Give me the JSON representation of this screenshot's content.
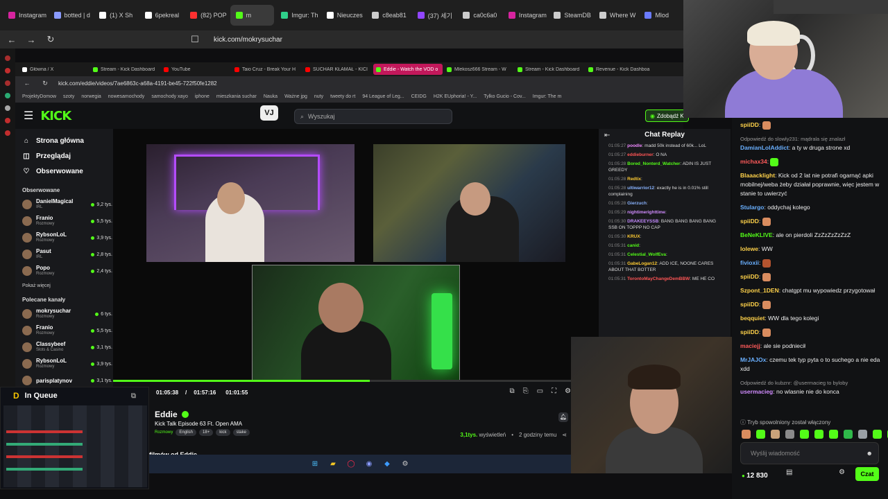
{
  "outer_browser": {
    "tabs": [
      {
        "label": "Instagram",
        "color": "#d6249f"
      },
      {
        "label": "botted | d",
        "color": "#8a9bff"
      },
      {
        "label": "(1) X Sh",
        "color": "#ffffff"
      },
      {
        "label": "6pekreal",
        "color": "#ffffff"
      },
      {
        "label": "(82) POP",
        "color": "#ff3030"
      },
      {
        "label": "m",
        "color": "#53fc18",
        "active": true
      },
      {
        "label": "Imgur: Th",
        "color": "#2fd08a"
      },
      {
        "label": "Nieuczes",
        "color": "#ffffff"
      },
      {
        "label": "c8eab81",
        "color": "#cccccc"
      },
      {
        "label": "(37) 세기",
        "color": "#9146ff"
      },
      {
        "label": "ca0c6a0",
        "color": "#cccccc"
      },
      {
        "label": "Instagram",
        "color": "#d6249f"
      },
      {
        "label": "SteamDB",
        "color": "#cccccc"
      },
      {
        "label": "Where W",
        "color": "#cccccc"
      },
      {
        "label": "Mlod",
        "color": "#6a7bff"
      }
    ],
    "url": "kick.com/mokrysuchar"
  },
  "inner_browser": {
    "tabs": [
      {
        "label": "Główna / X",
        "color": "#ffffff"
      },
      {
        "label": "Stream - Kick Dashboard",
        "color": "#53fc18"
      },
      {
        "label": "YouTube",
        "color": "#ff0000"
      },
      {
        "label": "Taio Cruz - Break Your H",
        "color": "#ff0000"
      },
      {
        "label": "SUCHAR KŁAMAŁ - KICI",
        "color": "#ff0000"
      },
      {
        "label": "Eddie - Watch the VOD o",
        "color": "#53fc18",
        "active": true
      },
      {
        "label": "Mlekosz666 Stream - W",
        "color": "#53fc18"
      },
      {
        "label": "Stream - Kick Dashboard",
        "color": "#53fc18"
      },
      {
        "label": "Revenue - Kick Dashboa",
        "color": "#53fc18"
      }
    ],
    "url": "kick.com/eddie/videos/7ae6863c-a68a-4191-be45-722f50fe1282",
    "bookmarks": [
      "ProjektyDomow",
      "szoty",
      "norwegia",
      "nowesamochody",
      "samochody xayo",
      "iphone",
      "mieszkania suchar",
      "Nauka",
      "Ważne jpg",
      "nuty",
      "tweety do rt",
      "94 League of Leg...",
      "CEIDG",
      "H2K EUphoria! - Y...",
      "Tylko Gucio - Cov...",
      "Imgur: The m"
    ]
  },
  "kick": {
    "logo": "KICK",
    "search_placeholder": "Wyszukaj",
    "cta": "Zdobądź K",
    "vj_label": "VJ",
    "nav": [
      {
        "label": "Strona główna",
        "icon": "home-icon",
        "glyph": "⌂"
      },
      {
        "label": "Przeglądaj",
        "icon": "browse-icon",
        "glyph": "◫"
      },
      {
        "label": "Obserwowane",
        "icon": "heart-icon",
        "glyph": "♡"
      }
    ],
    "followed_title": "Obserwowane",
    "followed": [
      {
        "name": "DanielMagical",
        "category": "IRL",
        "viewers": "9,2 tys."
      },
      {
        "name": "Franio",
        "category": "Rozmowy",
        "viewers": "5,5 tys."
      },
      {
        "name": "RybsonLoL",
        "category": "Rozmowy",
        "viewers": "3,9 tys."
      },
      {
        "name": "Pasut",
        "category": "IRL",
        "viewers": "2,8 tys."
      },
      {
        "name": "Popo",
        "category": "Rozmowy",
        "viewers": "2,4 tys."
      }
    ],
    "show_more": "Pokaż więcej",
    "recommended_title": "Polecane kanały",
    "recommended": [
      {
        "name": "mokrysuchar",
        "category": "Rozmowy",
        "viewers": "6 tys."
      },
      {
        "name": "Franio",
        "category": "Rozmowy",
        "viewers": "5,5 tys."
      },
      {
        "name": "Classybeef",
        "category": "Slots & Casino",
        "viewers": "3,1 tys."
      },
      {
        "name": "RybsonLoL",
        "category": "Rozmowy",
        "viewers": "3,9 tys."
      },
      {
        "name": "parisplatynov",
        "category": "",
        "viewers": "3,1 tys."
      }
    ],
    "video": {
      "current_time": "01:05:38",
      "duration": "01:57:16",
      "hover_time": "01:01:55",
      "progress": 0.56,
      "streamer": "Eddie",
      "title": "Kick Talk Episode 63 Ft. Open AMA",
      "category": "Rozmowy",
      "tags": [
        "English",
        "18+",
        "kick",
        "stake"
      ],
      "views": "3,1tys.",
      "views_label": "wyświetleń",
      "age": "2 godziny temu",
      "more_from": "filmów od Eddie"
    },
    "replay": {
      "title": "Chat Replay",
      "messages": [
        {
          "time": "01:05:27",
          "user": "poodle",
          "color": "#f08aff",
          "text": "madd 50k instead of 60k... LoL"
        },
        {
          "time": "01:05:27",
          "user": "eddieburner",
          "color": "#ff5555",
          "text": "O NA"
        },
        {
          "time": "01:05:28",
          "user": "Bored_Nonterd_Watcher",
          "color": "#53fc18",
          "text": "ADIN IS JUST GREEDY"
        },
        {
          "time": "01:05:28",
          "user": "Redtix",
          "color": "#ffcc33",
          "text": ""
        },
        {
          "time": "01:05:28",
          "user": "ultiwarrior12",
          "color": "#8ab4ff",
          "text": "exactly he is in 0.01% still complaining"
        },
        {
          "time": "01:05:28",
          "user": "Gierzuch",
          "color": "#8ab4ff",
          "text": ""
        },
        {
          "time": "01:05:29",
          "user": "nightimerighttime",
          "color": "#d18cff",
          "text": ""
        },
        {
          "time": "01:05:30",
          "user": "DRAKEEYSSB",
          "color": "#c58cff",
          "text": "BANG BANG BANG BANG SSB ON TOPPP NO CAP"
        },
        {
          "time": "01:05:30",
          "user": "KRUX",
          "color": "#ffcc33",
          "text": ""
        },
        {
          "time": "01:05:31",
          "user": "canid",
          "color": "#53fc18",
          "text": ""
        },
        {
          "time": "01:05:31",
          "user": "Celestial_WolfEva",
          "color": "#53fc18",
          "text": ""
        },
        {
          "time": "01:05:31",
          "user": "GabeLogan12",
          "color": "#ffcc33",
          "text": "ADD ICE, NOONE CARES ABOUT THAT BOTTER"
        },
        {
          "time": "01:05:31",
          "user": "TorontoMayChangeDemBBW",
          "color": "#ff5555",
          "text": "ME HE CO"
        }
      ]
    }
  },
  "queue": {
    "title": "In Queue"
  },
  "live_chat": {
    "messages": [
      {
        "user": "spiiDD",
        "color": "#ffd24a",
        "text": "",
        "emote": "#d98c5f"
      },
      {
        "reply": "Odpowiedź do slowly231: mądrala się znalazł"
      },
      {
        "user": "DamianLolAddict",
        "color": "#6ab0ff",
        "text": "a ty w druga strone xd"
      },
      {
        "user": "michax34",
        "color": "#ff5a5a",
        "text": "",
        "emote": "#53fc18"
      },
      {
        "user": "Blaaacklight",
        "color": "#ffd24a",
        "text": "Kick od 2 lat nie potrafi ogarnąć apki mobilnej/weba żeby działał poprawnie, więc jestem w stanie to uwierzyć"
      },
      {
        "user": "Stulargo",
        "color": "#6ab0ff",
        "text": "oddychaj kolego"
      },
      {
        "user": "spiiDD",
        "color": "#ffd24a",
        "text": "",
        "emote": "#d98c5f"
      },
      {
        "user": "BeNeKLIVE",
        "color": "#53fc18",
        "text": "ale on pierdoli ZzZzZzZzZzZ"
      },
      {
        "user": "lolewe",
        "color": "#ffd24a",
        "text": "WW"
      },
      {
        "user": "fivioxii",
        "color": "#6ab0ff",
        "text": "",
        "emote": "#b5542f"
      },
      {
        "user": "spiiDD",
        "color": "#ffd24a",
        "text": "",
        "emote": "#d98c5f"
      },
      {
        "user": "Szpont_1DEN",
        "color": "#ffd24a",
        "text": "chatgpt mu wypowiedz przygotował"
      },
      {
        "user": "spiiDD",
        "color": "#ffd24a",
        "text": "",
        "emote": "#d98c5f"
      },
      {
        "user": "beqquiet",
        "color": "#ffd24a",
        "text": "WW dla tego kolegi"
      },
      {
        "user": "spiiDD",
        "color": "#ffd24a",
        "text": "",
        "emote": "#d98c5f"
      },
      {
        "user": "maciejj",
        "color": "#ff5a5a",
        "text": "ale sie podniecił"
      },
      {
        "user": "MrJAJOx",
        "color": "#6ab0ff",
        "text": "czemu tek typ pyta o to suchego a nie eda xdd"
      },
      {
        "reply": "Odpowiedź do kubznr: @usermacieg to byloby"
      },
      {
        "user": "usermacieg",
        "color": "#d18cff",
        "text": "no wlasnie nie do konca"
      }
    ],
    "slow_mode": "Tryb spowolniony został włączony",
    "emotes": [
      "#d98c5f",
      "#53fc18",
      "#c9a27a",
      "#8a8a8a",
      "#53fc18",
      "#53fc18",
      "#53fc18",
      "#2fb84a",
      "#9aa0a6",
      "#53fc18",
      "#53fc18"
    ],
    "input_placeholder": "Wyślij wiadomość",
    "viewer_count": "12 830",
    "send_label": "Czat"
  }
}
